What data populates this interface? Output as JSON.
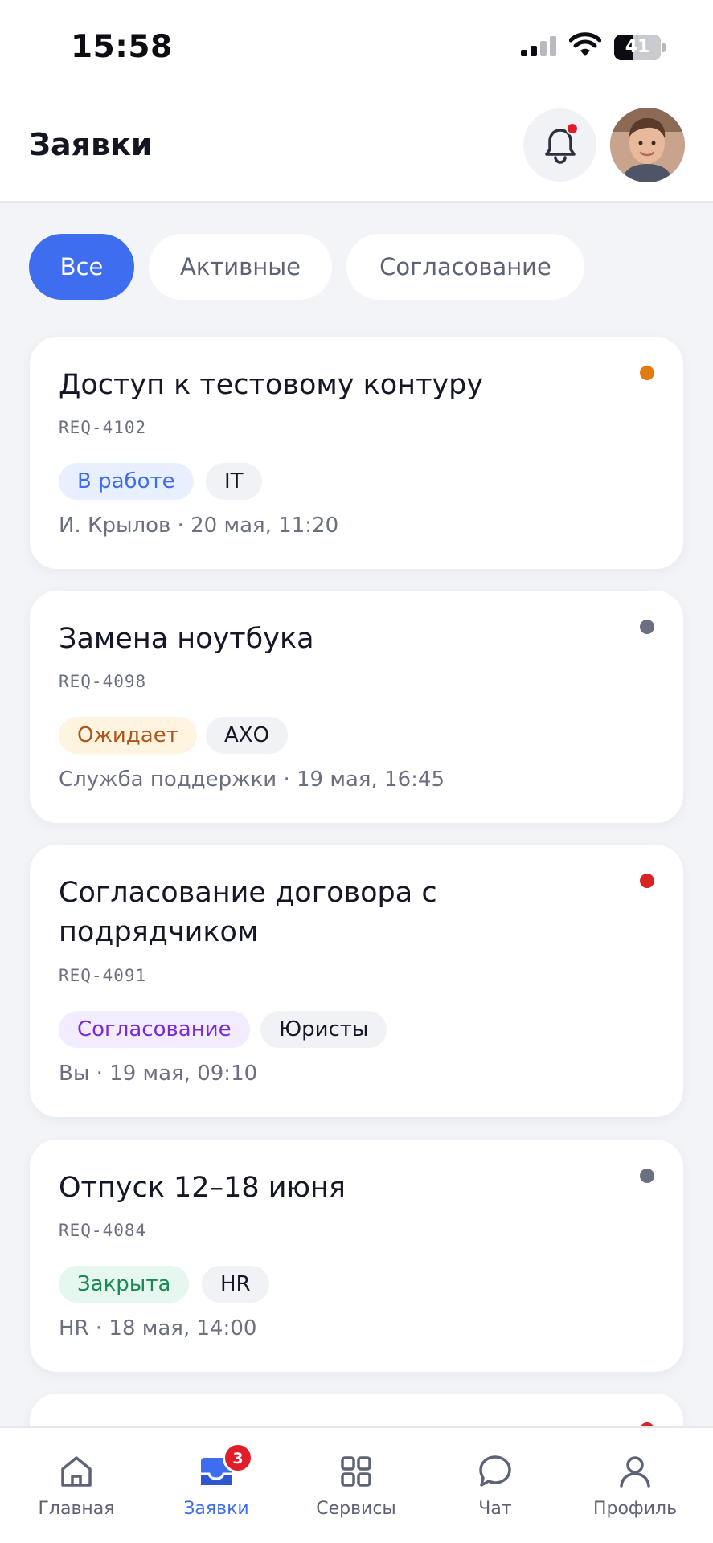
{
  "status_bar": {
    "time": "15:58",
    "battery": "41",
    "battery_level_percent": 41
  },
  "header": {
    "title": "Заявки",
    "has_notifications": true
  },
  "filters": [
    {
      "label": "Все",
      "active": true
    },
    {
      "label": "Активные",
      "active": false
    },
    {
      "label": "Согласование",
      "active": false
    }
  ],
  "requests": [
    {
      "title": "Доступ к тестовому контуру",
      "code": "REQ-4102",
      "status": "В работе",
      "category": "IT",
      "meta": "И. Крылов · 20 мая, 11:20",
      "indicator_color": "#e07b0f"
    },
    {
      "title": "Замена ноутбука",
      "code": "REQ-4098",
      "status": "Ожидает",
      "category": "АХО",
      "meta": "Служба поддержки · 19 мая, 16:45",
      "indicator_color": "#6b7080"
    },
    {
      "title": "Согласование договора с подрядчиком",
      "code": "REQ-4091",
      "status": "Согласование",
      "category": "Юристы",
      "meta": "Вы · 19 мая, 09:10",
      "indicator_color": "#d92424"
    },
    {
      "title": "Отпуск 12–18 июня",
      "code": "REQ-4084",
      "status": "Закрыта",
      "category": "HR",
      "meta": "HR · 18 мая, 14:00",
      "indicator_color": "#6b7080"
    }
  ],
  "status_colors": {
    "in_progress": {
      "bg": "#e8efff",
      "fg": "#3f6df0"
    },
    "waiting": {
      "bg": "#fff4e0",
      "fg": "#b0541a"
    },
    "approval": {
      "bg": "#f3ecff",
      "fg": "#7a2bd6"
    },
    "closed": {
      "bg": "#e5f7ee",
      "fg": "#1b8a55"
    },
    "category": {
      "bg": "#f1f2f6",
      "fg": "#141726"
    }
  },
  "nav": {
    "items": [
      {
        "label": "Главная",
        "icon": "home-icon",
        "active": false
      },
      {
        "label": "Заявки",
        "icon": "inbox-icon",
        "active": true,
        "badge": "3"
      },
      {
        "label": "Сервисы",
        "icon": "grid-icon",
        "active": false
      },
      {
        "label": "Чат",
        "icon": "chat-bubble-icon",
        "active": false
      },
      {
        "label": "Профиль",
        "icon": "user-icon",
        "active": false
      }
    ]
  },
  "colors": {
    "accent": "#3f6df0",
    "alert": "#e11d2a",
    "background": "#f2f4f8"
  }
}
